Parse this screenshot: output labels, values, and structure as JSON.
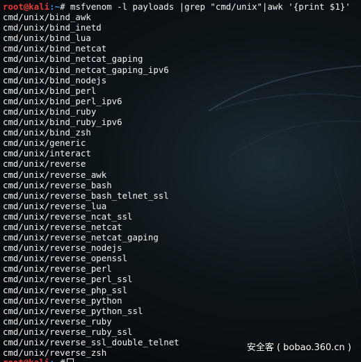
{
  "window": {
    "type": "terminal"
  },
  "prompt": {
    "user_host": "root@kali",
    "path": ":~",
    "symbol": "#",
    "command": " msfvenom -l payloads |grep \"cmd/unix\"|awk '{print $1}'"
  },
  "output": [
    "cmd/unix/bind_awk",
    "cmd/unix/bind_inetd",
    "cmd/unix/bind_lua",
    "cmd/unix/bind_netcat",
    "cmd/unix/bind_netcat_gaping",
    "cmd/unix/bind_netcat_gaping_ipv6",
    "cmd/unix/bind_nodejs",
    "cmd/unix/bind_perl",
    "cmd/unix/bind_perl_ipv6",
    "cmd/unix/bind_ruby",
    "cmd/unix/bind_ruby_ipv6",
    "cmd/unix/bind_zsh",
    "cmd/unix/generic",
    "cmd/unix/interact",
    "cmd/unix/reverse",
    "cmd/unix/reverse_awk",
    "cmd/unix/reverse_bash",
    "cmd/unix/reverse_bash_telnet_ssl",
    "cmd/unix/reverse_lua",
    "cmd/unix/reverse_ncat_ssl",
    "cmd/unix/reverse_netcat",
    "cmd/unix/reverse_netcat_gaping",
    "cmd/unix/reverse_nodejs",
    "cmd/unix/reverse_openssl",
    "cmd/unix/reverse_perl",
    "cmd/unix/reverse_perl_ssl",
    "cmd/unix/reverse_php_ssl",
    "cmd/unix/reverse_python",
    "cmd/unix/reverse_python_ssl",
    "cmd/unix/reverse_ruby",
    "cmd/unix/reverse_ruby_ssl",
    "cmd/unix/reverse_ssl_double_telnet",
    "cmd/unix/reverse_zsh"
  ],
  "watermark": "安全客 ( bobao.360.cn )",
  "colors": {
    "background": "#0d1418",
    "text": "#f2f2f2",
    "user_host": "#e53b3b",
    "path": "#4d8de8"
  }
}
